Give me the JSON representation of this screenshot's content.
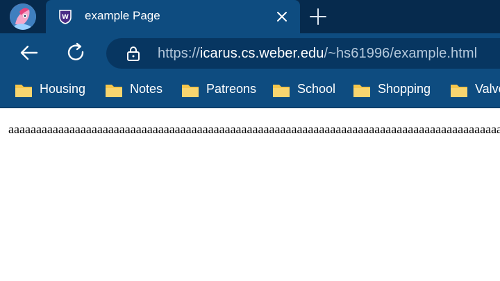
{
  "browser": {
    "tab": {
      "title": "example Page",
      "favicon": "shield-w-favicon",
      "close_icon": "close-icon"
    },
    "new_tab_icon": "plus-icon",
    "profile_icon": "profile-avatar"
  },
  "toolbar": {
    "back_icon": "back-arrow-icon",
    "reload_icon": "reload-icon",
    "lock_icon": "lock-icon",
    "url_scheme": "https://",
    "url_host": "icarus.cs.weber.edu",
    "url_path": "/~hs61996/example.html"
  },
  "bookmarks": [
    {
      "label": "Housing",
      "icon": "folder-icon"
    },
    {
      "label": "Notes",
      "icon": "folder-icon"
    },
    {
      "label": "Patreons",
      "icon": "folder-icon"
    },
    {
      "label": "School",
      "icon": "folder-icon"
    },
    {
      "label": "Shopping",
      "icon": "folder-icon"
    },
    {
      "label": "Valve",
      "icon": "folder-icon"
    }
  ],
  "page": {
    "text": "aaaaaaaaaaaaaaaaaaaaaaaaaaaaaaaaaaaaaaaaaaaaaaaaaaaaaaaaaaaaaaaaaaaaaaaaaaaaaaaaaaaaaaaaaaaaaaaaaa"
  },
  "colors": {
    "tabstrip": "#062a4d",
    "toolbar": "#0e4c80",
    "omnibox": "#073661",
    "folder": "#f5c64b"
  }
}
